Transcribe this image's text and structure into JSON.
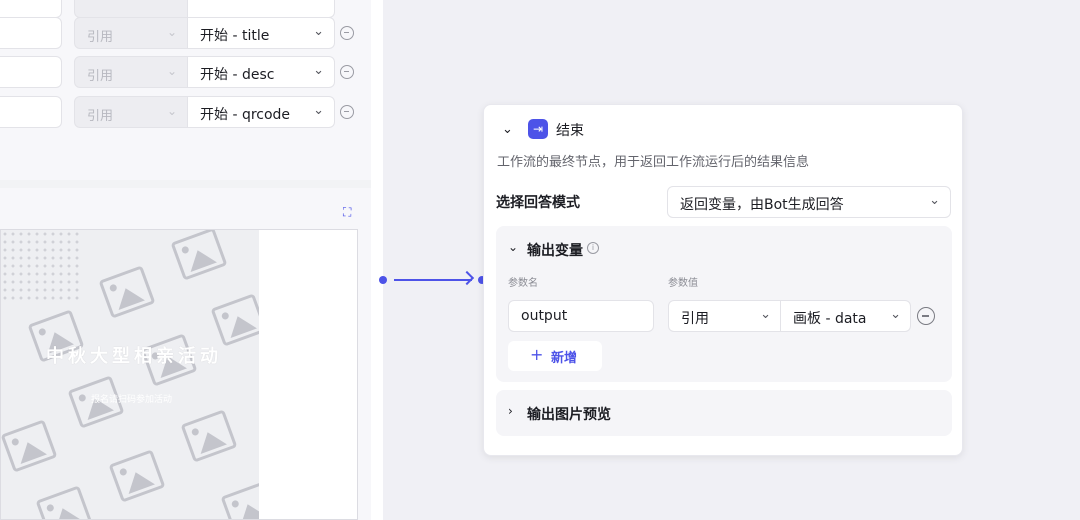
{
  "left_node": {
    "params": [
      {
        "type": "引用",
        "value": "开始 - title"
      },
      {
        "type": "引用",
        "value": "开始 - desc"
      },
      {
        "type": "引用",
        "value": "开始 - qrcode"
      }
    ],
    "poster": {
      "title": "中秋大型相亲活动",
      "subtitle": "报名请扫码参加活动"
    }
  },
  "end_node": {
    "title": "结束",
    "description": "工作流的最终节点，用于返回工作流运行后的结果信息",
    "answer_mode": {
      "label": "选择回答模式",
      "value": "返回变量，由Bot生成回答"
    },
    "output_vars": {
      "title": "输出变量",
      "col_name": "参数名",
      "col_value": "参数值",
      "rows": [
        {
          "name": "output",
          "type": "引用",
          "value": "画板 - data"
        }
      ],
      "add_label": "新增"
    },
    "image_preview": {
      "title": "输出图片预览"
    }
  },
  "colors": {
    "accent": "#4d53e8",
    "canvas_bg": "#f0f0f5"
  }
}
